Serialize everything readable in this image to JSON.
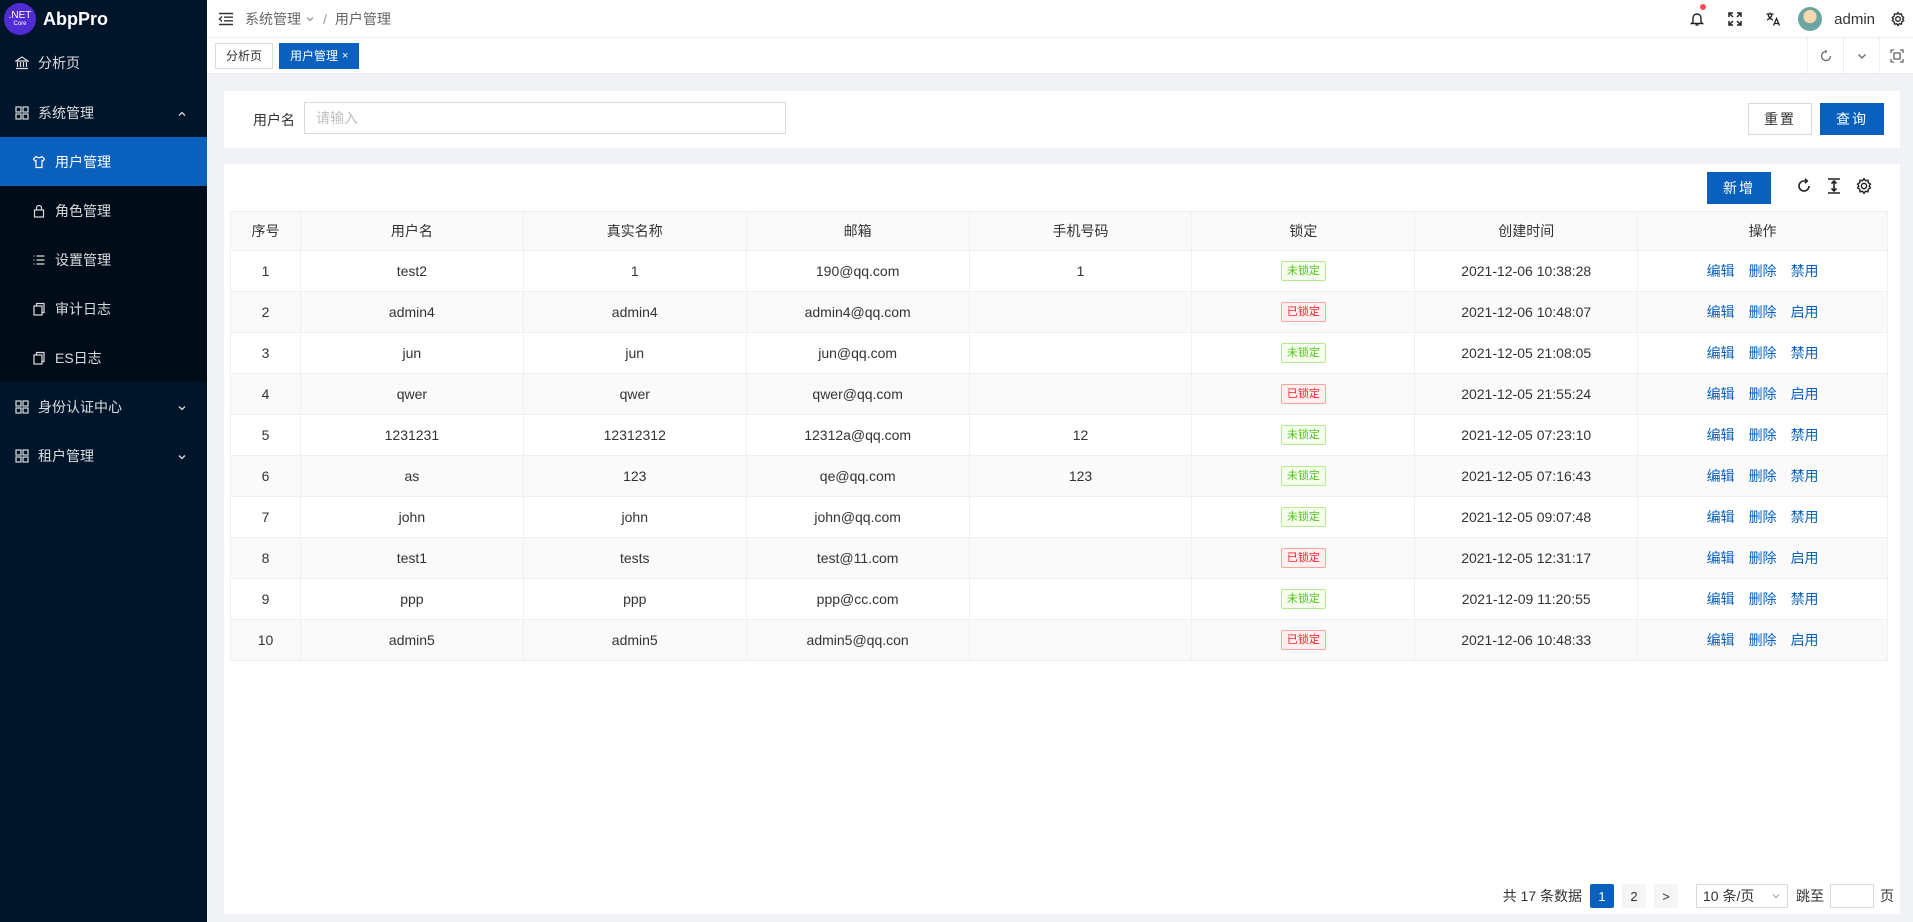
{
  "app": {
    "logo_line1": ".NET",
    "logo_line2": "Core",
    "title": "AbpPro"
  },
  "sidebar": {
    "items": [
      {
        "label": "分析页",
        "icon": "bank-icon"
      },
      {
        "label": "系统管理",
        "icon": "appstore-icon",
        "expanded": true
      },
      {
        "label": "用户管理",
        "icon": "skin-icon",
        "active": true
      },
      {
        "label": "角色管理",
        "icon": "lock-icon"
      },
      {
        "label": "设置管理",
        "icon": "list-icon"
      },
      {
        "label": "审计日志",
        "icon": "copy-icon"
      },
      {
        "label": "ES日志",
        "icon": "copy-icon"
      },
      {
        "label": "身份认证中心",
        "icon": "appstore-icon"
      },
      {
        "label": "租户管理",
        "icon": "appstore-icon"
      }
    ]
  },
  "header": {
    "breadcrumb": [
      "系统管理",
      "用户管理"
    ],
    "breadcrumb_sep": "/",
    "username": "admin"
  },
  "tabs": [
    {
      "label": "分析页"
    },
    {
      "label": "用户管理",
      "close": "×"
    }
  ],
  "search": {
    "label": "用户名",
    "placeholder": "请输入",
    "reset_label": "重置",
    "query_label": "查询"
  },
  "table": {
    "add_label": "新增",
    "columns": [
      "序号",
      "用户名",
      "真实名称",
      "邮箱",
      "手机号码",
      "锁定",
      "创建时间",
      "操作"
    ],
    "rows": [
      {
        "no": "1",
        "username": "test2",
        "realname": "1",
        "email": "190@qq.com",
        "phone": "1",
        "lock": "未锁定",
        "created": "2021-12-06 10:38:28",
        "toggle": "禁用"
      },
      {
        "no": "2",
        "username": "admin4",
        "realname": "admin4",
        "email": "admin4@qq.com",
        "phone": "",
        "lock": "已锁定",
        "created": "2021-12-06 10:48:07",
        "toggle": "启用"
      },
      {
        "no": "3",
        "username": "jun",
        "realname": "jun",
        "email": "jun@qq.com",
        "phone": "",
        "lock": "未锁定",
        "created": "2021-12-05 21:08:05",
        "toggle": "禁用"
      },
      {
        "no": "4",
        "username": "qwer",
        "realname": "qwer",
        "email": "qwer@qq.com",
        "phone": "",
        "lock": "已锁定",
        "created": "2021-12-05 21:55:24",
        "toggle": "启用"
      },
      {
        "no": "5",
        "username": "1231231",
        "realname": "12312312",
        "email": "12312a@qq.com",
        "phone": "12",
        "lock": "未锁定",
        "created": "2021-12-05 07:23:10",
        "toggle": "禁用"
      },
      {
        "no": "6",
        "username": "as",
        "realname": "123",
        "email": "qe@qq.com",
        "phone": "123",
        "lock": "未锁定",
        "created": "2021-12-05 07:16:43",
        "toggle": "禁用"
      },
      {
        "no": "7",
        "username": "john",
        "realname": "john",
        "email": "john@qq.com",
        "phone": "",
        "lock": "未锁定",
        "created": "2021-12-05 09:07:48",
        "toggle": "禁用"
      },
      {
        "no": "8",
        "username": "test1",
        "realname": "tests",
        "email": "test@11.com",
        "phone": "",
        "lock": "已锁定",
        "created": "2021-12-05 12:31:17",
        "toggle": "启用"
      },
      {
        "no": "9",
        "username": "ppp",
        "realname": "ppp",
        "email": "ppp@cc.com",
        "phone": "",
        "lock": "未锁定",
        "created": "2021-12-09 11:20:55",
        "toggle": "禁用"
      },
      {
        "no": "10",
        "username": "admin5",
        "realname": "admin5",
        "email": "admin5@qq.con",
        "phone": "",
        "lock": "已锁定",
        "created": "2021-12-06 10:48:33",
        "toggle": "启用"
      }
    ],
    "edit_label": "编辑",
    "delete_label": "删除"
  },
  "pagination": {
    "total_text": "共 17 条数据",
    "pages": [
      "1",
      "2"
    ],
    "current": "1",
    "next": ">",
    "page_size": "10 条/页",
    "jump_label": "跳至",
    "page_suffix": "页"
  },
  "colors": {
    "primary": "#0960bd",
    "sidebar_bg": "#001529",
    "unlocked": "#52c41a",
    "locked": "#f5222d"
  }
}
